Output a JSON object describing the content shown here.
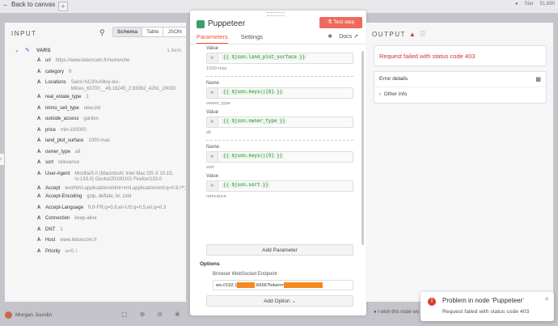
{
  "topbar": {
    "back_label": "Back to canvas",
    "plus_label": "+",
    "star_label": "Star",
    "star_count": "51,890"
  },
  "input": {
    "heading": "INPUT",
    "tabs": [
      "Schema",
      "Table",
      "JSON"
    ],
    "active_tab": "Schema",
    "vars_label": "VARS",
    "vars_count": "1 item",
    "fields": [
      {
        "key": "url",
        "val": "https://www.leboncoin.fr/recherche"
      },
      {
        "key": "category",
        "val": "9"
      },
      {
        "key": "Locations",
        "val": "Saint-%C3%A9loy-les-Mines_63700__46.16245_2.83362_4261_20000"
      },
      {
        "key": "real_estate_type",
        "val": "1"
      },
      {
        "key": "immo_sell_type",
        "val": "new,old"
      },
      {
        "key": "outside_access",
        "val": "garden"
      },
      {
        "key": "price",
        "val": "min-100000"
      },
      {
        "key": "land_plot_surface",
        "val": "1000-max"
      },
      {
        "key": "owner_type",
        "val": "all"
      },
      {
        "key": "sort",
        "val": "relevance"
      },
      {
        "key": "User-Agent",
        "val": "Mozilla/5.0 (Macintosh; Intel Mac OS X 10.15; rv:133.0) Gecko/20100101 Firefox/133.0"
      },
      {
        "key": "Accept",
        "val": "text/html,application/xhtml+xml,application/xml;q=0.9,*/*;q=0.8"
      },
      {
        "key": "Accept-Encoding",
        "val": "gzip, deflate, br, zstd"
      },
      {
        "key": "Accept-Language",
        "val": "fr,fr-FR;q=0.8,en-US;q=0.5,en;q=0.3"
      },
      {
        "key": "Connection",
        "val": "keep-alive"
      },
      {
        "key": "DNT",
        "val": "1"
      },
      {
        "key": "Host",
        "val": "www.leboncoin.fr"
      },
      {
        "key": "Priority",
        "val": "u=0, i"
      }
    ]
  },
  "ndv": {
    "title": "Puppeteer",
    "test_step": "Test step",
    "tab_parameters": "Parameters",
    "tab_settings": "Settings",
    "docs_label": "Docs",
    "params": [
      {
        "type": "value",
        "label": "Value",
        "code": "{{ $json.land_plot_surface }}",
        "hint": "1000-max"
      },
      {
        "type": "name",
        "label": "Name",
        "code": "{{ $json.keys()[8] }}",
        "hint": "owner_type"
      },
      {
        "type": "value",
        "label": "Value",
        "code": "{{ $json.owner_type }}",
        "hint": "all"
      },
      {
        "type": "name",
        "label": "Name",
        "code": "{{ $json.keys()[9] }}",
        "hint": "sort"
      },
      {
        "type": "value",
        "label": "Value",
        "code": "{{ $json.sort }}",
        "hint": "relevance"
      }
    ],
    "add_parameter": "Add Parameter",
    "options_label": "Options",
    "ws_label": "Browser WebSocket Endpoint",
    "ws_prefix": "ws://192.1",
    "ws_mid": ":6666?token=",
    "add_option": "Add Option"
  },
  "output": {
    "heading": "OUTPUT",
    "error_message": "Request failed with status code 403",
    "details_title": "Error details",
    "other_info": "Other info"
  },
  "bottom": {
    "user_name": "Morgan Jourdin",
    "wish_text": "I wish this node wo"
  },
  "toast": {
    "title": "Problem in node ‘Puppeteer‘",
    "message": "Request failed with status code 403"
  }
}
